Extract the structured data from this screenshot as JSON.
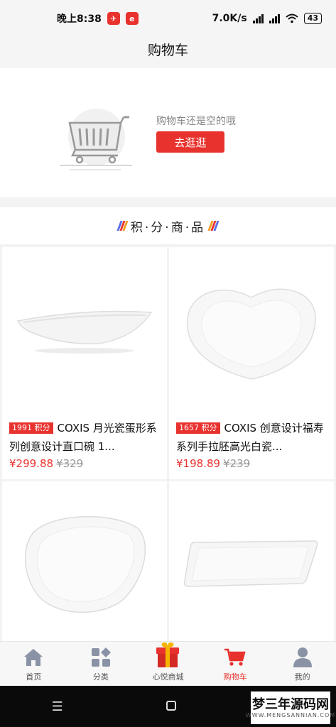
{
  "status": {
    "time": "晚上8:38",
    "app_badge_1": "✈",
    "app_badge_2": "e",
    "speed": "7.0K/s",
    "battery": "43"
  },
  "navbar": {
    "title": "购物车"
  },
  "empty_cart": {
    "message": "购物车还是空的哦",
    "button_label": "去逛逛"
  },
  "section": {
    "title": "积·分·商·品"
  },
  "products": [
    {
      "points_label": "1991 积分",
      "title": "COXIS 月光瓷蛋形系列创意设计直口碗 1...",
      "price": "¥299.88",
      "old_price": "¥329",
      "shape": "boat"
    },
    {
      "points_label": "1657 积分",
      "title": "COXIS 创意设计福寿系列手拉胚高光白瓷...",
      "price": "¥198.89",
      "old_price": "¥239",
      "shape": "heart"
    },
    {
      "points_label": "",
      "title": "",
      "price": "",
      "old_price": "",
      "shape": "egg"
    },
    {
      "points_label": "",
      "title": "",
      "price": "",
      "old_price": "",
      "shape": "rect"
    }
  ],
  "tabbar": {
    "items": [
      {
        "label": "首页",
        "icon": "home-icon",
        "active": false
      },
      {
        "label": "分类",
        "icon": "category-icon",
        "active": false
      },
      {
        "label": "心悦商城",
        "icon": "gift-icon",
        "active": false
      },
      {
        "label": "购物车",
        "icon": "cart-icon",
        "active": true
      },
      {
        "label": "我的",
        "icon": "user-icon",
        "active": false
      }
    ]
  },
  "watermark": {
    "main": "梦三年源码网",
    "sub": "WWW.MENGSANNIAN.COM"
  },
  "colors": {
    "accent": "#e8322e",
    "background": "#f3f3f3"
  }
}
